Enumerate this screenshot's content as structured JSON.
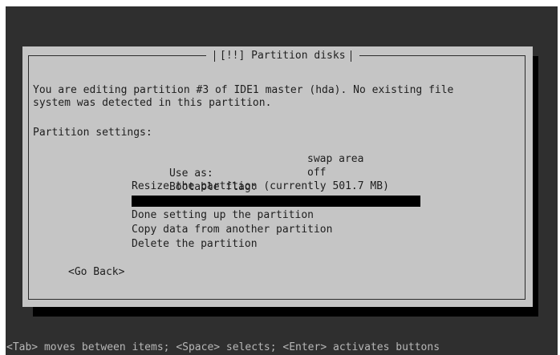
{
  "dialog": {
    "title_left": "[!!]",
    "title_right": "Partition disks",
    "description_line1": "You are editing partition #3 of IDE1 master (hda). No existing file",
    "description_line2": "system was detected in this partition.",
    "settings_heading": "Partition settings:",
    "settings": [
      {
        "label": "Use as:",
        "value": "swap area"
      },
      {
        "label": "Bootable flag:",
        "value": "off"
      }
    ],
    "resize_item": "Resize the partition (currently 501.7 MB)",
    "actions": [
      "Done setting up the partition",
      "Copy data from another partition",
      "Delete the partition"
    ],
    "go_back": "<Go Back>"
  },
  "statusbar": {
    "help": "<Tab> moves between items; <Space> selects; <Enter> activates buttons"
  },
  "colors": {
    "background": "#2f2f2f",
    "dialog": "#c5c5c5",
    "highlight": "#000000"
  }
}
